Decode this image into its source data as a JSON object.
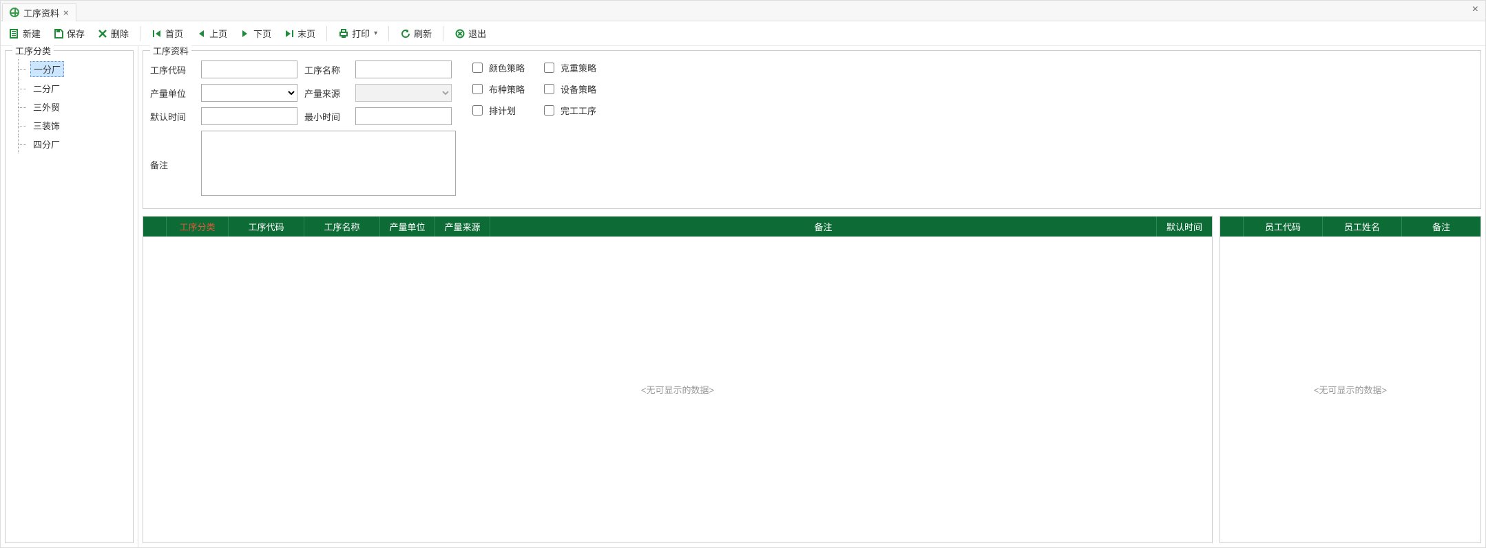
{
  "tab": {
    "title": "工序资料"
  },
  "toolbar": {
    "new": "新建",
    "save": "保存",
    "delete": "删除",
    "first": "首页",
    "prev": "上页",
    "next": "下页",
    "last": "末页",
    "print": "打印",
    "refresh": "刷新",
    "exit": "退出"
  },
  "left": {
    "group_title": "工序分类",
    "items": [
      "一分厂",
      "二分厂",
      "三外贸",
      "三装饰",
      "四分厂"
    ],
    "selected_index": 0
  },
  "form": {
    "group_title": "工序资料",
    "labels": {
      "code": "工序代码",
      "name": "工序名称",
      "unit": "产量单位",
      "source": "产量来源",
      "def_time": "默认时间",
      "min_time": "最小时间",
      "remark": "备注"
    },
    "values": {
      "code": "",
      "name": "",
      "unit": "",
      "source": "",
      "def_time": "",
      "min_time": "",
      "remark": ""
    },
    "checks": {
      "color_strategy": "颜色策略",
      "weight_strategy": "克重策略",
      "fabric_strategy": "布种策略",
      "device_strategy": "设备策略",
      "plan": "排计划",
      "finish": "完工工序"
    }
  },
  "table_left": {
    "columns": [
      "工序分类",
      "工序代码",
      "工序名称",
      "产量单位",
      "产量来源",
      "备注",
      "默认时间"
    ],
    "nodata": "<无可显示的数据>"
  },
  "table_right": {
    "columns": [
      "员工代码",
      "员工姓名",
      "备注"
    ],
    "nodata": "<无可显示的数据>"
  }
}
